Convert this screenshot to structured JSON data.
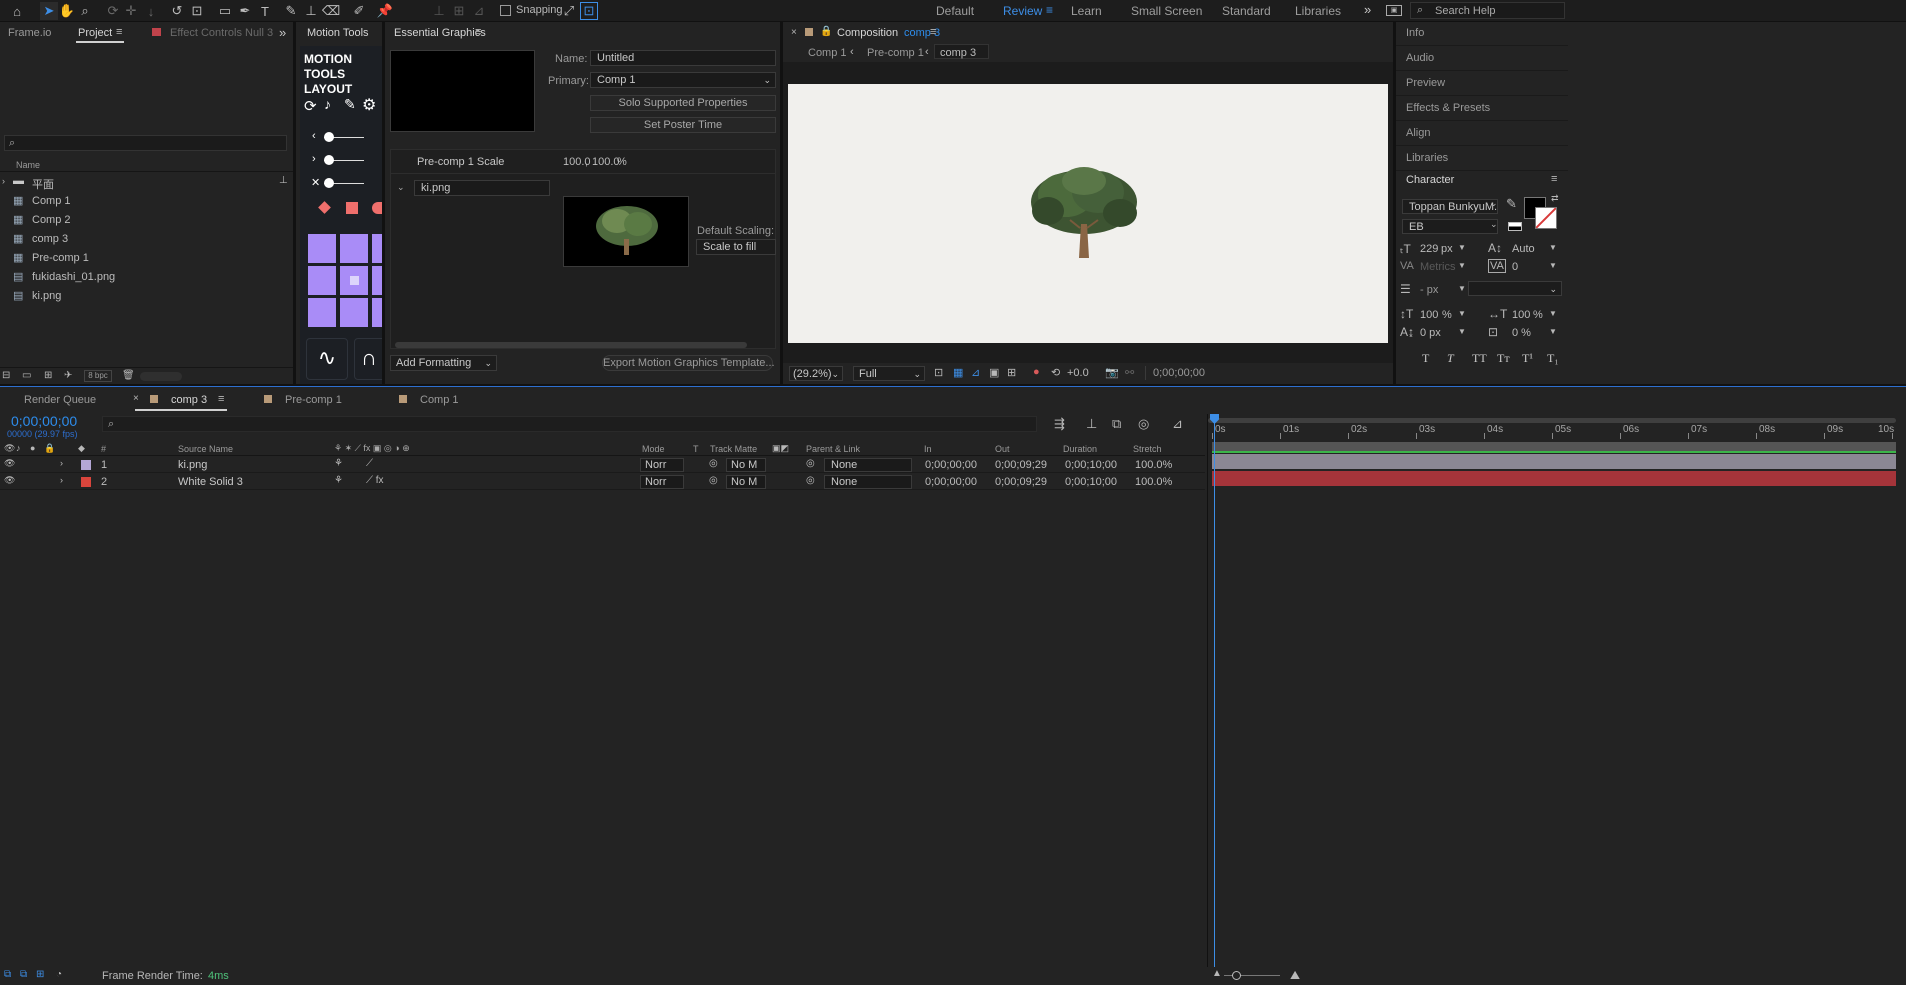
{
  "toolbar": {
    "snapping_label": "Snapping",
    "workspaces": [
      "Default",
      "Review",
      "Learn",
      "Small Screen",
      "Standard",
      "Libraries"
    ],
    "active_workspace": "Review",
    "search_placeholder": "Search Help"
  },
  "project_panel": {
    "tabs": [
      "Frame.io",
      "Project",
      "Effect Controls Null 3"
    ],
    "column_name": "Name",
    "items": [
      {
        "name": "平面",
        "type": "folder"
      },
      {
        "name": "Comp 1",
        "type": "comp"
      },
      {
        "name": "Comp 2",
        "type": "comp"
      },
      {
        "name": "comp 3",
        "type": "comp"
      },
      {
        "name": "Pre-comp 1",
        "type": "comp"
      },
      {
        "name": "fukidashi_01.png",
        "type": "file"
      },
      {
        "name": "ki.png",
        "type": "file"
      }
    ],
    "bpc": "8 bpc"
  },
  "motion_tools": {
    "tab": "Motion Tools",
    "title_lines": [
      "MOTION",
      "TOOLS",
      "LAYOUT"
    ]
  },
  "essential_graphics": {
    "tab": "Essential Graphics",
    "name_label": "Name:",
    "name_value": "Untitled",
    "primary_label": "Primary:",
    "primary_value": "Comp 1",
    "solo_button": "Solo Supported Properties",
    "poster_button": "Set Poster Time",
    "scale_label": "Pre-comp 1 Scale",
    "scale_x": "100.0",
    "scale_sep": ",",
    "scale_y": "100.0",
    "scale_unit": "%",
    "media_name": "ki.png",
    "default_scaling_label": "Default Scaling:",
    "default_scaling_value": "Scale to fill",
    "add_formatting": "Add Formatting",
    "export_button": "Export Motion Graphics Template..."
  },
  "composition": {
    "tab_prefix": "Composition",
    "tab_name": "comp 3",
    "breadcrumbs": [
      "Comp 1",
      "Pre-comp 1",
      "comp 3"
    ],
    "zoom": "(29.2%)",
    "resolution": "Full",
    "exposure": "+0.0",
    "timecode": "0;00;00;00"
  },
  "right_panel": {
    "items": [
      "Info",
      "Audio",
      "Preview",
      "Effects & Presets",
      "Align",
      "Libraries"
    ],
    "character_title": "Character",
    "font_family": "Toppan BunkyuM...",
    "font_style": "EB",
    "font_size": "229",
    "font_size_unit": "px",
    "leading": "Auto",
    "kerning": "Metrics",
    "tracking": "0",
    "stroke_width": "- px",
    "vert_scale": "100",
    "vert_scale_unit": "%",
    "horiz_scale": "100",
    "horiz_scale_unit": "%",
    "baseline_shift": "0 px",
    "tsume": "0 %",
    "type_styles": [
      "T",
      "T",
      "TT",
      "Tт",
      "T¹",
      "T₁"
    ]
  },
  "timeline": {
    "tabs": [
      "Render Queue",
      "comp 3",
      "Pre-comp 1",
      "Comp 1"
    ],
    "active_tab": "comp 3",
    "timecode": "0;00;00;00",
    "fps_info": "00000 (29.97 fps)",
    "columns": [
      "#",
      "Source Name",
      "Mode",
      "T",
      "Track Matte",
      "Parent & Link",
      "In",
      "Out",
      "Duration",
      "Stretch"
    ],
    "layers": [
      {
        "num": "1",
        "name": "ki.png",
        "mode": "Norr",
        "matte": "No M",
        "parent": "None",
        "in": "0;00;00;00",
        "out": "0;00;09;29",
        "duration": "0;00;10;00",
        "stretch": "100.0%",
        "color": "#b4a7d6",
        "bar_color": "#8b8794"
      },
      {
        "num": "2",
        "name": "White Solid 3",
        "mode": "Norr",
        "matte": "No M",
        "parent": "None",
        "in": "0;00;00;00",
        "out": "0;00;09;29",
        "duration": "0;00;10;00",
        "stretch": "100.0%",
        "color": "#d9453c",
        "bar_color": "#a5343a"
      }
    ],
    "ruler_labels": [
      "0s",
      "01s",
      "02s",
      "03s",
      "04s",
      "05s",
      "06s",
      "07s",
      "08s",
      "09s",
      "10s"
    ],
    "render_time_label": "Frame Render Time:",
    "render_time_value": "4ms"
  }
}
